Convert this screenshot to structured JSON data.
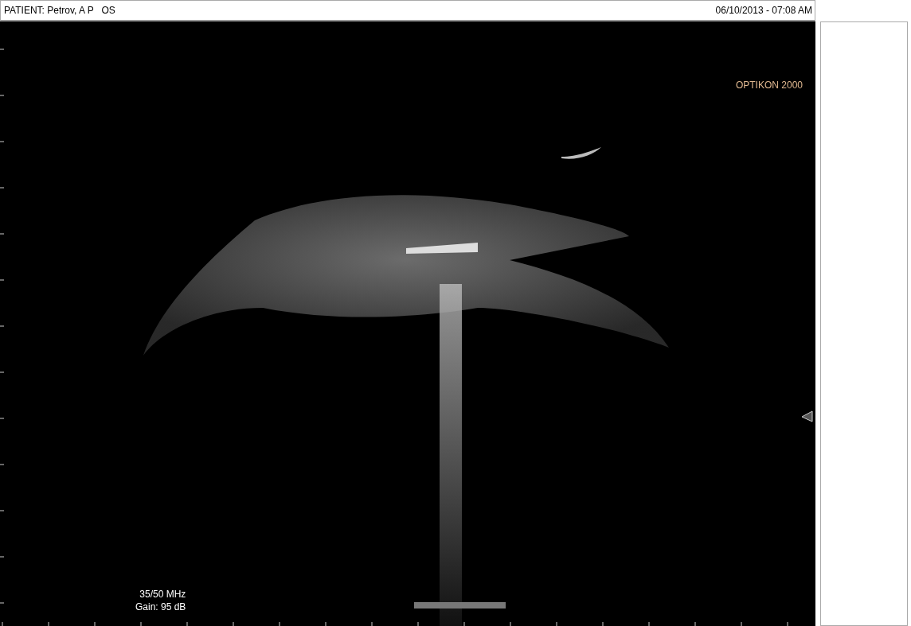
{
  "header": {
    "patient": "PATIENT: Petrov, A P   OS",
    "datetime": "06/10/2013 - 07:08 AM"
  },
  "scan": {
    "device_label": "OPTIKON 2000",
    "frequency": "35/50 MHz",
    "gain": "Gain: 95 dB"
  }
}
